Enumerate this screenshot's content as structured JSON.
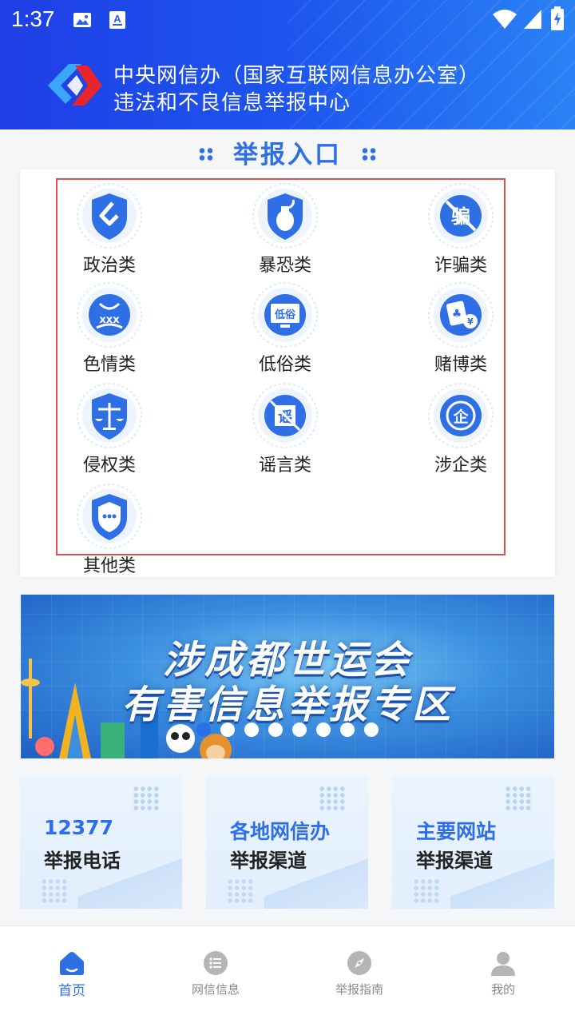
{
  "status_bar": {
    "time": "1:37"
  },
  "header": {
    "title_line1": "中央网信办（国家互联网信息办公室）",
    "title_line2": "违法和不良信息举报中心"
  },
  "section": {
    "title": "举报入口"
  },
  "categories": [
    {
      "label": "政治类",
      "icon": "shield-s-icon"
    },
    {
      "label": "暴恐类",
      "icon": "grenade-shield-icon"
    },
    {
      "label": "诈骗类",
      "icon": "no-fraud-icon"
    },
    {
      "label": "色情类",
      "icon": "adult-content-icon"
    },
    {
      "label": "低俗类",
      "icon": "vulgar-monitor-icon"
    },
    {
      "label": "赌博类",
      "icon": "gambling-card-icon"
    },
    {
      "label": "侵权类",
      "icon": "scales-shield-icon"
    },
    {
      "label": "谣言类",
      "icon": "no-rumor-icon"
    },
    {
      "label": "涉企类",
      "icon": "enterprise-icon"
    },
    {
      "label": "其他类",
      "icon": "chat-shield-icon"
    }
  ],
  "banner": {
    "line1": "涉成都世运会",
    "line2": "有害信息举报专区",
    "pages": 8,
    "active_page": 1
  },
  "channels": [
    {
      "top": "12377",
      "bottom": "举报电话"
    },
    {
      "top": "各地网信办",
      "bottom": "举报渠道"
    },
    {
      "top": "主要网站",
      "bottom": "举报渠道"
    }
  ],
  "bottom_nav": [
    {
      "label": "首页",
      "icon": "home-icon",
      "active": true
    },
    {
      "label": "网信信息",
      "icon": "list-icon",
      "active": false
    },
    {
      "label": "举报指南",
      "icon": "compass-icon",
      "active": false
    },
    {
      "label": "我的",
      "icon": "user-icon",
      "active": false
    }
  ],
  "colors": {
    "accent": "#2f6fe6",
    "header_start": "#1f3fe6",
    "header_end": "#2a82f5",
    "highlight_border": "#e04f4f"
  }
}
